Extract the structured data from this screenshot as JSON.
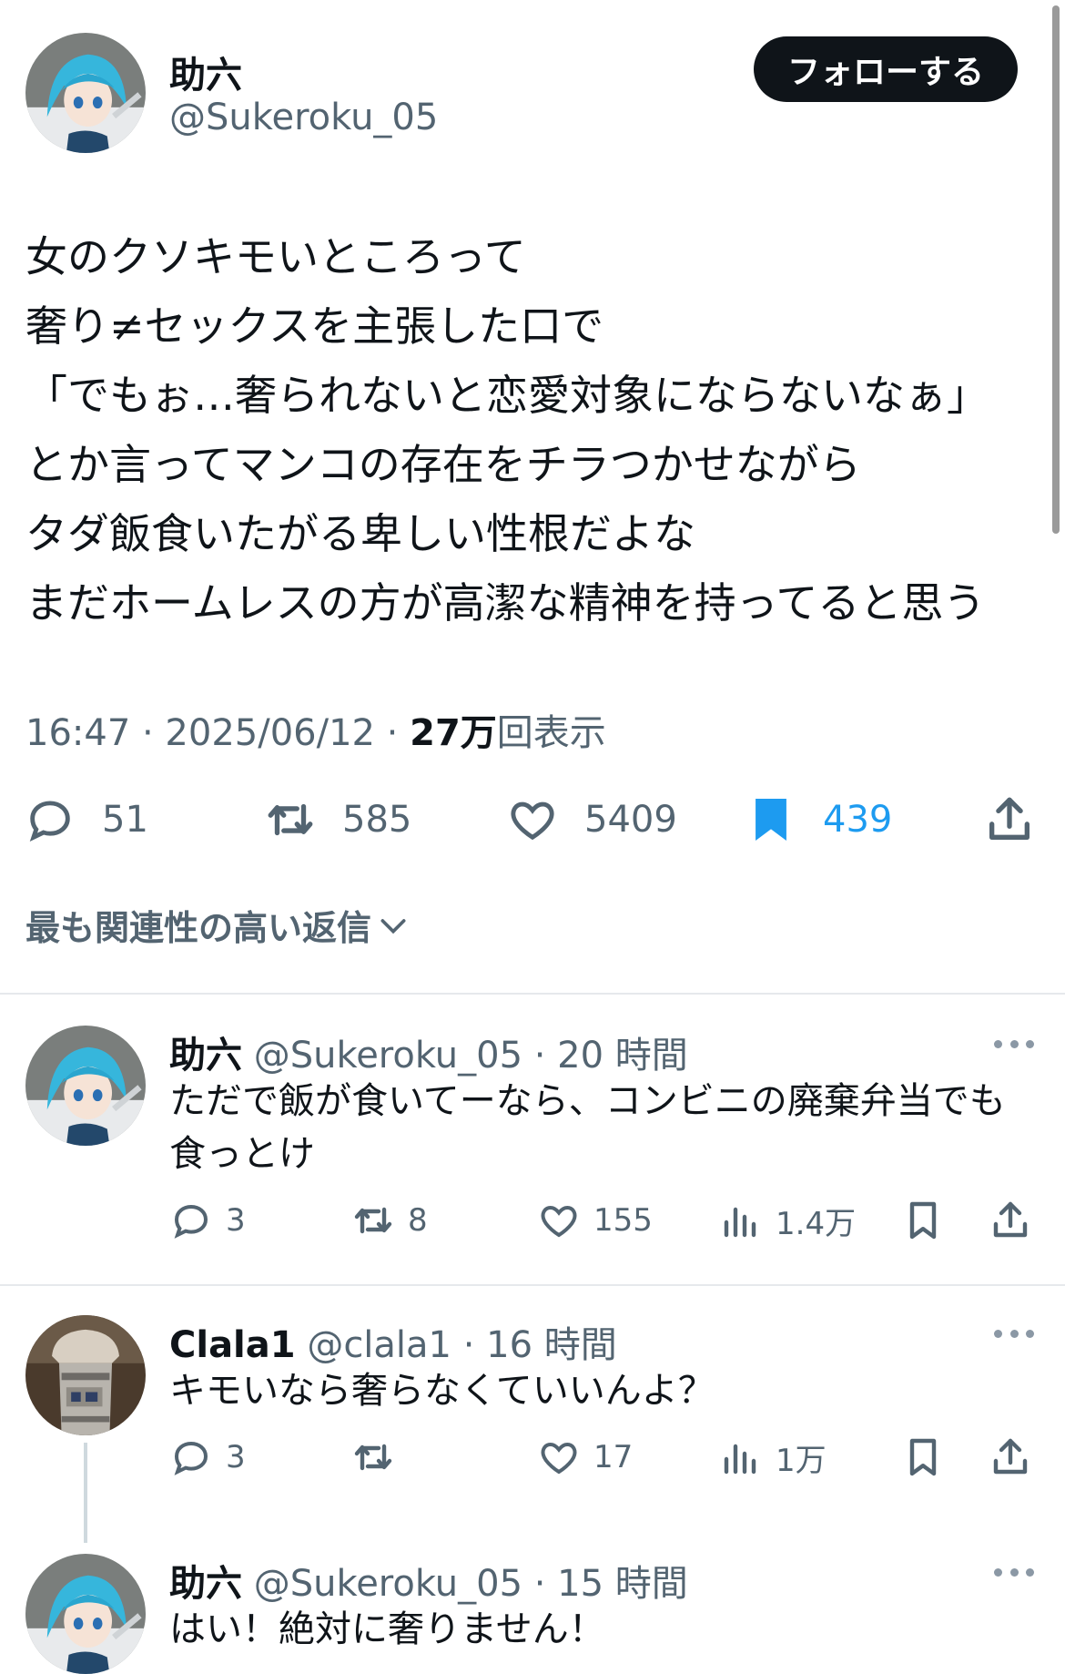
{
  "main_tweet": {
    "name": "助六",
    "handle": "@Sukeroku_05",
    "follow_label": "フォローする",
    "lines": [
      "女のクソキモいところって",
      "奢り≠セックスを主張した口で",
      "「でもぉ…奢られないと恋愛対象にならないなぁ」",
      "とか言ってマンコの存在をチラつかせながら",
      "タダ飯食いたがる卑しい性根だよな",
      "まだホームレスの方が高潔な精神を持ってると思う"
    ],
    "time": "16:47 · 2025/06/12 · ",
    "views_count": "27万",
    "views_label": "回表示",
    "replies": "51",
    "reposts": "585",
    "likes": "5409",
    "bookmarks": "439",
    "accent_color": "#1d9bf0"
  },
  "sort_label": "最も関連性の高い返信",
  "replies": [
    {
      "name": "助六",
      "handle": "@Sukeroku_05 · 20 時間",
      "text": "ただで飯が食いてーなら、コンビニの廃棄弁当でも食っとけ",
      "replies": "3",
      "reposts": "8",
      "likes": "155",
      "views": "1.4万"
    },
    {
      "name": "Clala1",
      "handle": "@clala1 · 16 時間",
      "text": "キモいなら奢らなくていいんよ？",
      "replies": "3",
      "reposts": "",
      "likes": "17",
      "views": "1万"
    },
    {
      "name": "助六",
      "handle": "@Sukeroku_05 · 15 時間",
      "text": "はい！絶対に奢りません！"
    }
  ],
  "icons": [
    "reply-icon",
    "repost-icon",
    "like-icon",
    "bookmark-icon",
    "share-icon",
    "views-icon",
    "more-icon",
    "chevron-down-icon"
  ]
}
